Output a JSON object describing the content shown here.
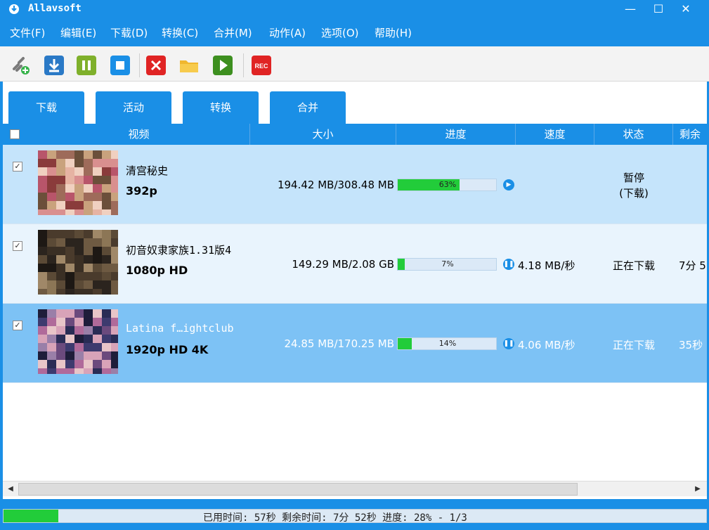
{
  "window": {
    "title": "Allavsoft",
    "minimize": "—",
    "maximize": "☐",
    "close": "✕"
  },
  "menu": [
    "文件(F)",
    "编辑(E)",
    "下载(D)",
    "转换(C)",
    "合并(M)",
    "动作(A)",
    "选项(O)",
    "帮助(H)"
  ],
  "toolbar": {
    "buttons": [
      {
        "name": "add-link-icon",
        "glyph": "🔗"
      },
      {
        "name": "download-icon",
        "glyph": "⬇"
      },
      {
        "name": "pause-icon",
        "glyph": "⏸"
      },
      {
        "name": "stop-icon",
        "glyph": "■"
      },
      {
        "name": "delete-icon",
        "glyph": "✕"
      },
      {
        "name": "folder-icon",
        "glyph": "📁"
      },
      {
        "name": "play-icon",
        "glyph": "▶"
      },
      {
        "name": "record-icon",
        "glyph": "REC"
      }
    ]
  },
  "tabs": [
    "下载",
    "活动",
    "转换",
    "合并"
  ],
  "columns": [
    "视频",
    "大小",
    "进度",
    "速度",
    "状态",
    "剩余"
  ],
  "rows": [
    {
      "title": "清宫秘史",
      "quality": "392p",
      "size": "194.42 MB/308.48 MB",
      "progress_label": "63%",
      "progress": 0.63,
      "speed": "",
      "status": "暂停\n(下载)",
      "remaining": "",
      "control": "play"
    },
    {
      "title": "初音奴隶家族1.31版4",
      "quality": "1080p HD",
      "size": "149.29 MB/2.08 GB",
      "progress_label": "7%",
      "progress": 0.07,
      "speed": "4.18 MB/秒",
      "status": "正在下载",
      "remaining": "7分 5",
      "control": "pause"
    },
    {
      "title": "Latina f…ightclub",
      "quality": "1920p HD 4K",
      "size": "24.85 MB/170.25 MB",
      "progress_label": "14%",
      "progress": 0.14,
      "speed": "4.06 MB/秒",
      "status": "正在下载",
      "remaining": "35秒",
      "control": "pause"
    }
  ],
  "statusbar": {
    "text": "已用时间: 57秒 剩余时间:  7分 52秒 进度: 28% - 1/3",
    "progress": 0.28
  }
}
